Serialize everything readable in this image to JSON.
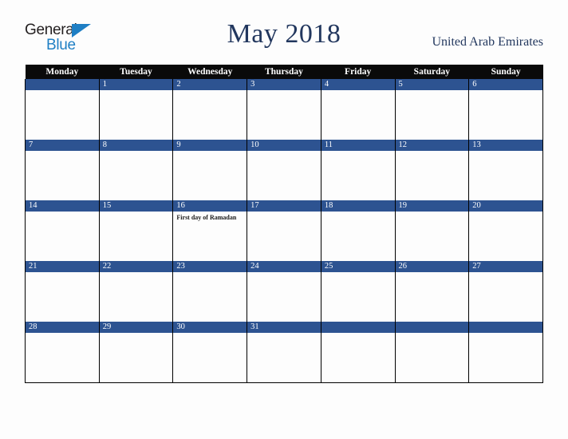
{
  "brand": {
    "name_part1": "General",
    "name_part2": "Blue",
    "triangle_icon": "triangle-icon",
    "accent_color": "#1f7fc4"
  },
  "header": {
    "title": "May 2018",
    "country": "United Arab Emirates",
    "title_color": "#22375e"
  },
  "calendar": {
    "weekday_headers": [
      "Monday",
      "Tuesday",
      "Wednesday",
      "Thursday",
      "Friday",
      "Saturday",
      "Sunday"
    ],
    "header_bg": "#0a0a0a",
    "daynum_bg": "#2d5391",
    "cell_bg": "#fdfdfd",
    "weeks": [
      [
        {
          "day": "",
          "note": ""
        },
        {
          "day": "1",
          "note": ""
        },
        {
          "day": "2",
          "note": ""
        },
        {
          "day": "3",
          "note": ""
        },
        {
          "day": "4",
          "note": ""
        },
        {
          "day": "5",
          "note": ""
        },
        {
          "day": "6",
          "note": ""
        }
      ],
      [
        {
          "day": "7",
          "note": ""
        },
        {
          "day": "8",
          "note": ""
        },
        {
          "day": "9",
          "note": ""
        },
        {
          "day": "10",
          "note": ""
        },
        {
          "day": "11",
          "note": ""
        },
        {
          "day": "12",
          "note": ""
        },
        {
          "day": "13",
          "note": ""
        }
      ],
      [
        {
          "day": "14",
          "note": ""
        },
        {
          "day": "15",
          "note": ""
        },
        {
          "day": "16",
          "note": "First day of Ramadan"
        },
        {
          "day": "17",
          "note": ""
        },
        {
          "day": "18",
          "note": ""
        },
        {
          "day": "19",
          "note": ""
        },
        {
          "day": "20",
          "note": ""
        }
      ],
      [
        {
          "day": "21",
          "note": ""
        },
        {
          "day": "22",
          "note": ""
        },
        {
          "day": "23",
          "note": ""
        },
        {
          "day": "24",
          "note": ""
        },
        {
          "day": "25",
          "note": ""
        },
        {
          "day": "26",
          "note": ""
        },
        {
          "day": "27",
          "note": ""
        }
      ],
      [
        {
          "day": "28",
          "note": ""
        },
        {
          "day": "29",
          "note": ""
        },
        {
          "day": "30",
          "note": ""
        },
        {
          "day": "31",
          "note": ""
        },
        {
          "day": "",
          "note": ""
        },
        {
          "day": "",
          "note": ""
        },
        {
          "day": "",
          "note": ""
        }
      ]
    ]
  }
}
